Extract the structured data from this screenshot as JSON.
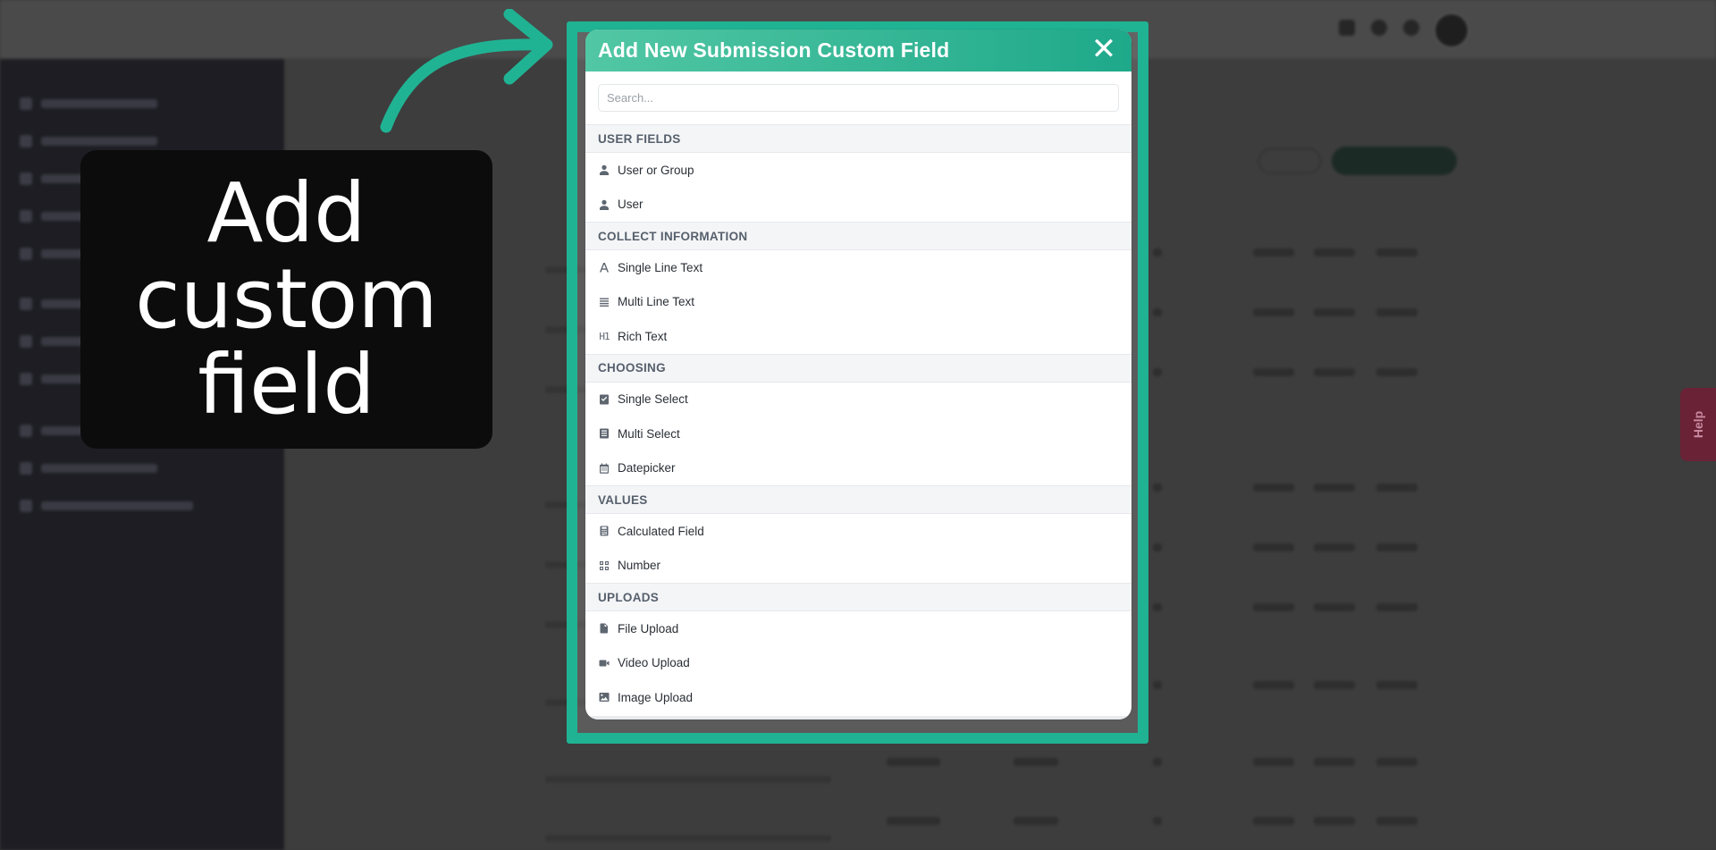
{
  "callout": {
    "text": "Add\ncustom\nfield"
  },
  "modal": {
    "title": "Add New Submission Custom Field",
    "close_symbol": "✕",
    "search": {
      "placeholder": "Search...",
      "value": ""
    },
    "groups": [
      {
        "header": "USER FIELDS",
        "items": [
          {
            "label": "User or Group",
            "icon": "user-icon"
          },
          {
            "label": "User",
            "icon": "user-icon"
          }
        ]
      },
      {
        "header": "COLLECT INFORMATION",
        "items": [
          {
            "label": "Single Line Text",
            "icon": "font-icon"
          },
          {
            "label": "Multi Line Text",
            "icon": "align-justify-icon"
          },
          {
            "label": "Rich Text",
            "icon": "heading-icon",
            "glyph": "H1"
          }
        ]
      },
      {
        "header": "CHOOSING",
        "items": [
          {
            "label": "Single Select",
            "icon": "check-square-icon"
          },
          {
            "label": "Multi Select",
            "icon": "list-box-icon"
          },
          {
            "label": "Datepicker",
            "icon": "calendar-icon"
          }
        ]
      },
      {
        "header": "VALUES",
        "items": [
          {
            "label": "Calculated Field",
            "icon": "calculator-icon"
          },
          {
            "label": "Number",
            "icon": "grid-icon"
          }
        ]
      },
      {
        "header": "UPLOADS",
        "items": [
          {
            "label": "File Upload",
            "icon": "file-icon"
          },
          {
            "label": "Video Upload",
            "icon": "video-icon"
          },
          {
            "label": "Image Upload",
            "icon": "image-icon"
          }
        ]
      }
    ]
  },
  "help_tab": {
    "label": "Help"
  },
  "colors": {
    "accent": "#20b393",
    "header_start": "#52c7a4",
    "header_end": "#1ea98a",
    "callout_bg": "#0c0c0c"
  }
}
